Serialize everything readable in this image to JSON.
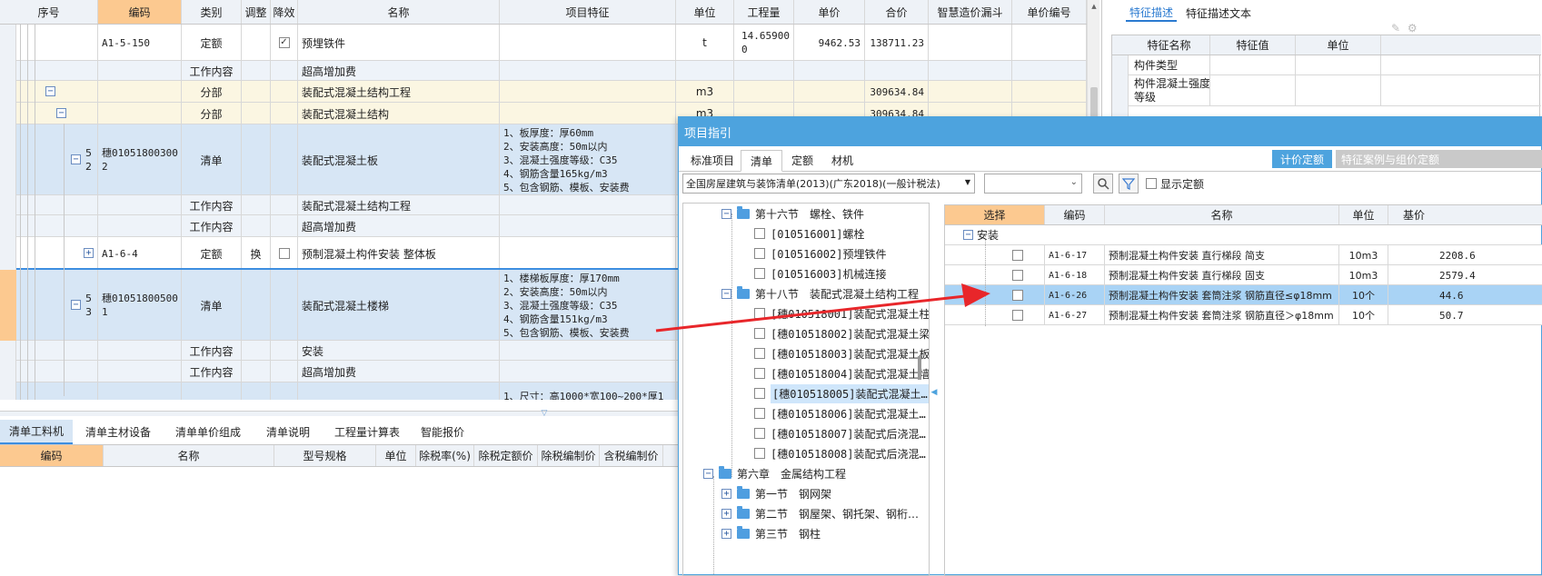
{
  "main_grid": {
    "headers": [
      "序号",
      "编码",
      "类别",
      "调整",
      "降效",
      "名称",
      "项目特征",
      "单位",
      "工程量",
      "单价",
      "合价",
      "智慧造价漏斗",
      "单价编号"
    ],
    "rows": [
      {
        "seq": "",
        "code": "A1-5-150",
        "type": "定额",
        "adjust": "",
        "reduce_check": "✓",
        "name": "预埋铁件",
        "feature": "",
        "unit": "t",
        "qty": "14.65900\n0",
        "price": "9462.53",
        "total": "138711.23"
      },
      {
        "seq": "",
        "code": "",
        "type": "工作内容",
        "adjust": "",
        "reduce_check": "",
        "name": "超高增加费",
        "feature": "",
        "unit": "",
        "qty": "",
        "price": "",
        "total": ""
      },
      {
        "seq": "",
        "code": "",
        "type": "分部",
        "adjust": "",
        "reduce_check": "",
        "name": "装配式混凝土结构工程",
        "feature": "",
        "unit": "m3",
        "qty": "",
        "price": "",
        "total": "309634.84"
      },
      {
        "seq": "",
        "code": "",
        "type": "分部",
        "adjust": "",
        "reduce_check": "",
        "name": "装配式混凝土结构",
        "feature": "",
        "unit": "m3",
        "qty": "",
        "price": "",
        "total": "309634.84"
      },
      {
        "seq": "5\n2",
        "code": "穗01051800300\n2",
        "type": "清单",
        "adjust": "",
        "reduce_check": "",
        "name": "装配式混凝土板",
        "feature": "1、板厚度：厚60mm\n2、安装高度：50m以内\n3、混凝土强度等级：C35\n4、钢筋含量165kg/m3\n5、包含钢筋、模板、安装费",
        "unit": "",
        "qty": "",
        "price": "",
        "total": ""
      },
      {
        "seq": "",
        "code": "",
        "type": "工作内容",
        "adjust": "",
        "reduce_check": "",
        "name": "装配式混凝土结构工程",
        "feature": "",
        "unit": "",
        "qty": "",
        "price": "",
        "total": ""
      },
      {
        "seq": "",
        "code": "",
        "type": "工作内容",
        "adjust": "",
        "reduce_check": "",
        "name": "超高增加费",
        "feature": "",
        "unit": "",
        "qty": "",
        "price": "",
        "total": ""
      },
      {
        "seq": "",
        "code": "A1-6-4",
        "type": "定额",
        "adjust": "换",
        "reduce_check": "",
        "name": "预制混凝土构件安装 整体板",
        "feature": "",
        "unit": "",
        "qty": "",
        "price": "",
        "total": ""
      },
      {
        "seq": "5\n3",
        "code": "穗01051800500\n1",
        "type": "清单",
        "adjust": "",
        "reduce_check": "",
        "name": "装配式混凝土楼梯",
        "feature": "1、楼梯板厚度：厚170mm\n2、安装高度：50m以内\n3、混凝土强度等级：C35\n4、钢筋含量151kg/m3\n5、包含钢筋、模板、安装费",
        "unit": "",
        "qty": "",
        "price": "",
        "total": ""
      },
      {
        "seq": "",
        "code": "",
        "type": "工作内容",
        "adjust": "",
        "reduce_check": "",
        "name": "安装",
        "feature": "",
        "unit": "",
        "qty": "",
        "price": "",
        "total": ""
      },
      {
        "seq": "",
        "code": "",
        "type": "工作内容",
        "adjust": "",
        "reduce_check": "",
        "name": "超高增加费",
        "feature": "",
        "unit": "",
        "qty": "",
        "price": "",
        "total": ""
      },
      {
        "seq": "",
        "code": "",
        "type": "",
        "adjust": "",
        "reduce_check": "",
        "name": "",
        "feature": "1、尺寸：高1000*宽100~200*厚1",
        "unit": "",
        "qty": "",
        "price": "",
        "total": ""
      }
    ]
  },
  "bottom_tabs": [
    "清单工料机",
    "清单主材设备",
    "清单单价组成",
    "清单说明",
    "工程量计算表",
    "智能报价"
  ],
  "bottom_headers": [
    "编码",
    "名称",
    "型号规格",
    "单位",
    "除税率(%)",
    "除税定额价",
    "除税编制价",
    "含税编制价"
  ],
  "right_panel": {
    "tabs": [
      "特征描述",
      "特征描述文本"
    ],
    "headers": [
      "特征名称",
      "特征值",
      "单位"
    ],
    "rows": [
      "构件类型",
      "构件混凝土强度\n等级"
    ]
  },
  "dialog": {
    "title": "项目指引",
    "tabs": [
      "标准项目",
      "清单",
      "定额",
      "材机"
    ],
    "btn_price": "计价定额",
    "btn_cases": "特征案例与组价定额",
    "standard": "全国房屋建筑与装饰清单(2013)(广东2018)(一般计税法)",
    "show_quota": "显示定额",
    "tree": [
      {
        "level": 1,
        "box": "−",
        "folder": true,
        "label": "第十六节　螺栓、铁件"
      },
      {
        "level": 2,
        "check": true,
        "label": "[010516001]螺栓"
      },
      {
        "level": 2,
        "check": true,
        "label": "[010516002]预埋铁件"
      },
      {
        "level": 2,
        "check": true,
        "label": "[010516003]机械连接"
      },
      {
        "level": 1,
        "box": "−",
        "folder": true,
        "label": "第十八节　装配式混凝土结构工程"
      },
      {
        "level": 2,
        "check": true,
        "label": "[穗010518001]装配式混凝土柱"
      },
      {
        "level": 2,
        "check": true,
        "label": "[穗010518002]装配式混凝土梁"
      },
      {
        "level": 2,
        "check": true,
        "label": "[穗010518003]装配式混凝土板"
      },
      {
        "level": 2,
        "check": true,
        "label": "[穗010518004]装配式混凝土墙"
      },
      {
        "level": 2,
        "check": true,
        "label": "[穗010518005]装配式混凝土…",
        "selected": true
      },
      {
        "level": 2,
        "check": true,
        "label": "[穗010518006]装配式混凝土…"
      },
      {
        "level": 2,
        "check": true,
        "label": "[穗010518007]装配式后浇混…"
      },
      {
        "level": 2,
        "check": true,
        "label": "[穗010518008]装配式后浇混…"
      },
      {
        "level": 0,
        "box": "−",
        "folder": true,
        "label": "第六章　金属结构工程"
      },
      {
        "level": 1,
        "box": "+",
        "folder": true,
        "label": "第一节　钢网架"
      },
      {
        "level": 1,
        "box": "+",
        "folder": true,
        "label": "第二节　钢屋架、钢托架、钢桁…"
      },
      {
        "level": 1,
        "box": "+",
        "folder": true,
        "label": "第三节　钢柱"
      }
    ],
    "list_headers": [
      "选择",
      "编码",
      "名称",
      "单位",
      "基价"
    ],
    "group": "安装",
    "list_rows": [
      {
        "code": "A1-6-17",
        "name": "预制混凝土构件安装 直行梯段 简支",
        "unit": "10m3",
        "price": "2208.6"
      },
      {
        "code": "A1-6-18",
        "name": "预制混凝土构件安装 直行梯段 固支",
        "unit": "10m3",
        "price": "2579.4"
      },
      {
        "code": "A1-6-26",
        "name": "预制混凝土构件安装 套筒注浆 钢筋直径≤φ18mm",
        "unit": "10个",
        "price": "44.6",
        "selected": true
      },
      {
        "code": "A1-6-27",
        "name": "预制混凝土构件安装 套筒注浆 钢筋直径＞φ18mm",
        "unit": "10个",
        "price": "50.7"
      }
    ]
  },
  "colors": {
    "header_bg": "#eef2f7",
    "orange": "#fcc990",
    "yellow_row": "#fbf6e2",
    "blue_row": "#d7e6f5",
    "selected_row": "#a9d3f5",
    "dialog_title": "#4da3de",
    "arrow": "#e8262a"
  }
}
